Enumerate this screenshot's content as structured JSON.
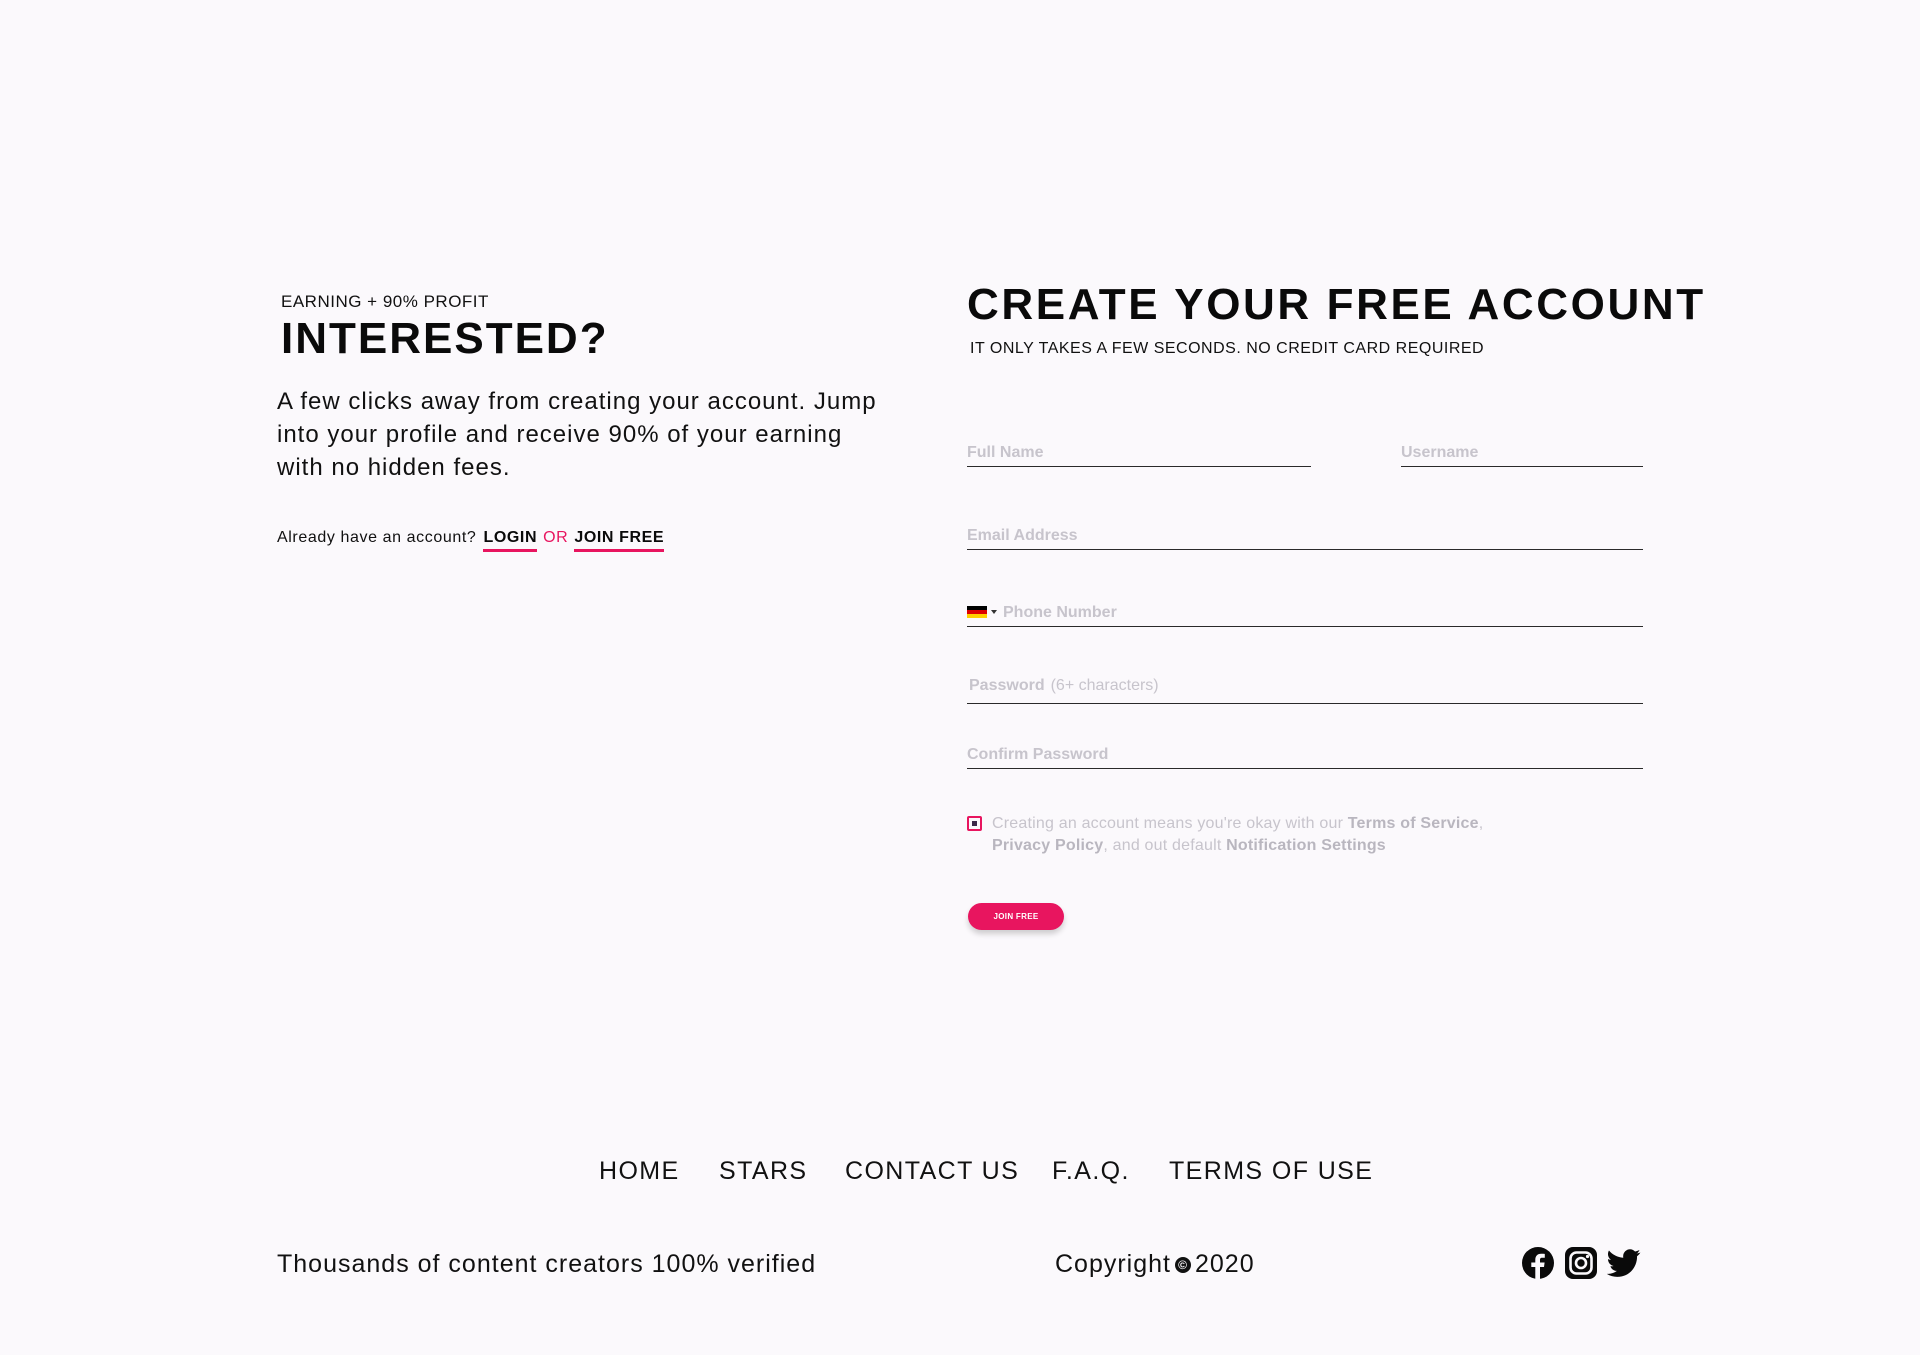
{
  "intro": {
    "eyebrow": "EARNING + 90% PROFIT",
    "title": "INTERESTED?",
    "body": "A few clicks away from creating your account. Jump into your profile and receive 90% of your earning with no hidden fees.",
    "account_prompt": "Already have an account?",
    "login_label": "LOGIN",
    "or_label": "OR",
    "join_label": "JOIN FREE"
  },
  "form": {
    "title": "CREATE YOUR FREE ACCOUNT",
    "subtitle": "IT ONLY TAKES A FEW SECONDS. NO CREDIT CARD REQUIRED",
    "full_name_placeholder": "Full Name",
    "username_placeholder": "Username",
    "email_placeholder": "Email Address",
    "phone_placeholder": "Phone Number",
    "phone_country_icon": "germany-flag-icon",
    "password_label": "Password",
    "password_hint": "(6+ characters)",
    "confirm_password_placeholder": "Confirm Password",
    "terms_prefix": "Creating an account means you're okay with our",
    "terms_of_service": "Terms of Service",
    "terms_comma": ",",
    "privacy_policy": "Privacy Policy",
    "terms_middle": ", and out default",
    "notification_settings": "Notification Settings",
    "submit_label": "JOIN FREE"
  },
  "footer": {
    "nav": [
      "HOME",
      "STARS",
      "CONTACT US",
      "F.A.Q.",
      "TERMS OF USE"
    ],
    "tagline": "Thousands of content creators 100% verified",
    "copyright_label": "Copyright",
    "copyright_symbol": "©",
    "copyright_year": "2020",
    "social_icons": [
      "facebook-icon",
      "instagram-icon",
      "twitter-icon"
    ]
  },
  "colors": {
    "accent": "#e8155f",
    "background": "#fbf9fc",
    "text": "#111111",
    "placeholder": "#c7c4cc"
  }
}
